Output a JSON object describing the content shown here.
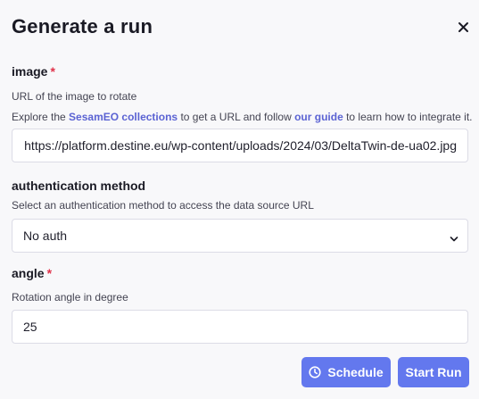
{
  "dialog": {
    "title": "Generate a run",
    "close_icon": "close-icon"
  },
  "image": {
    "label": "image",
    "required_mark": "*",
    "description": "URL of the image to rotate",
    "help_prefix": "Explore the ",
    "help_link1": "SesamEO collections",
    "help_middle": " to get a URL and follow ",
    "help_link2": "our guide",
    "help_suffix": " to learn how to integrate it.",
    "value": "https://platform.destine.eu/wp-content/uploads/2024/03/DeltaTwin-de-ua02.jpg"
  },
  "auth": {
    "label": "authentication method",
    "description": "Select an authentication method to access the data source URL",
    "selected": "No auth",
    "chevron_icon": "chevron-down-icon"
  },
  "angle": {
    "label": "angle",
    "required_mark": "*",
    "description": "Rotation angle in degree",
    "value": "25"
  },
  "actions": {
    "schedule_label": "Schedule",
    "schedule_icon": "clock-icon",
    "start_label": "Start Run"
  },
  "colors": {
    "accent": "#6378ee",
    "link": "#5b63d3",
    "required": "#e0324a",
    "background": "#f8f8fa"
  }
}
